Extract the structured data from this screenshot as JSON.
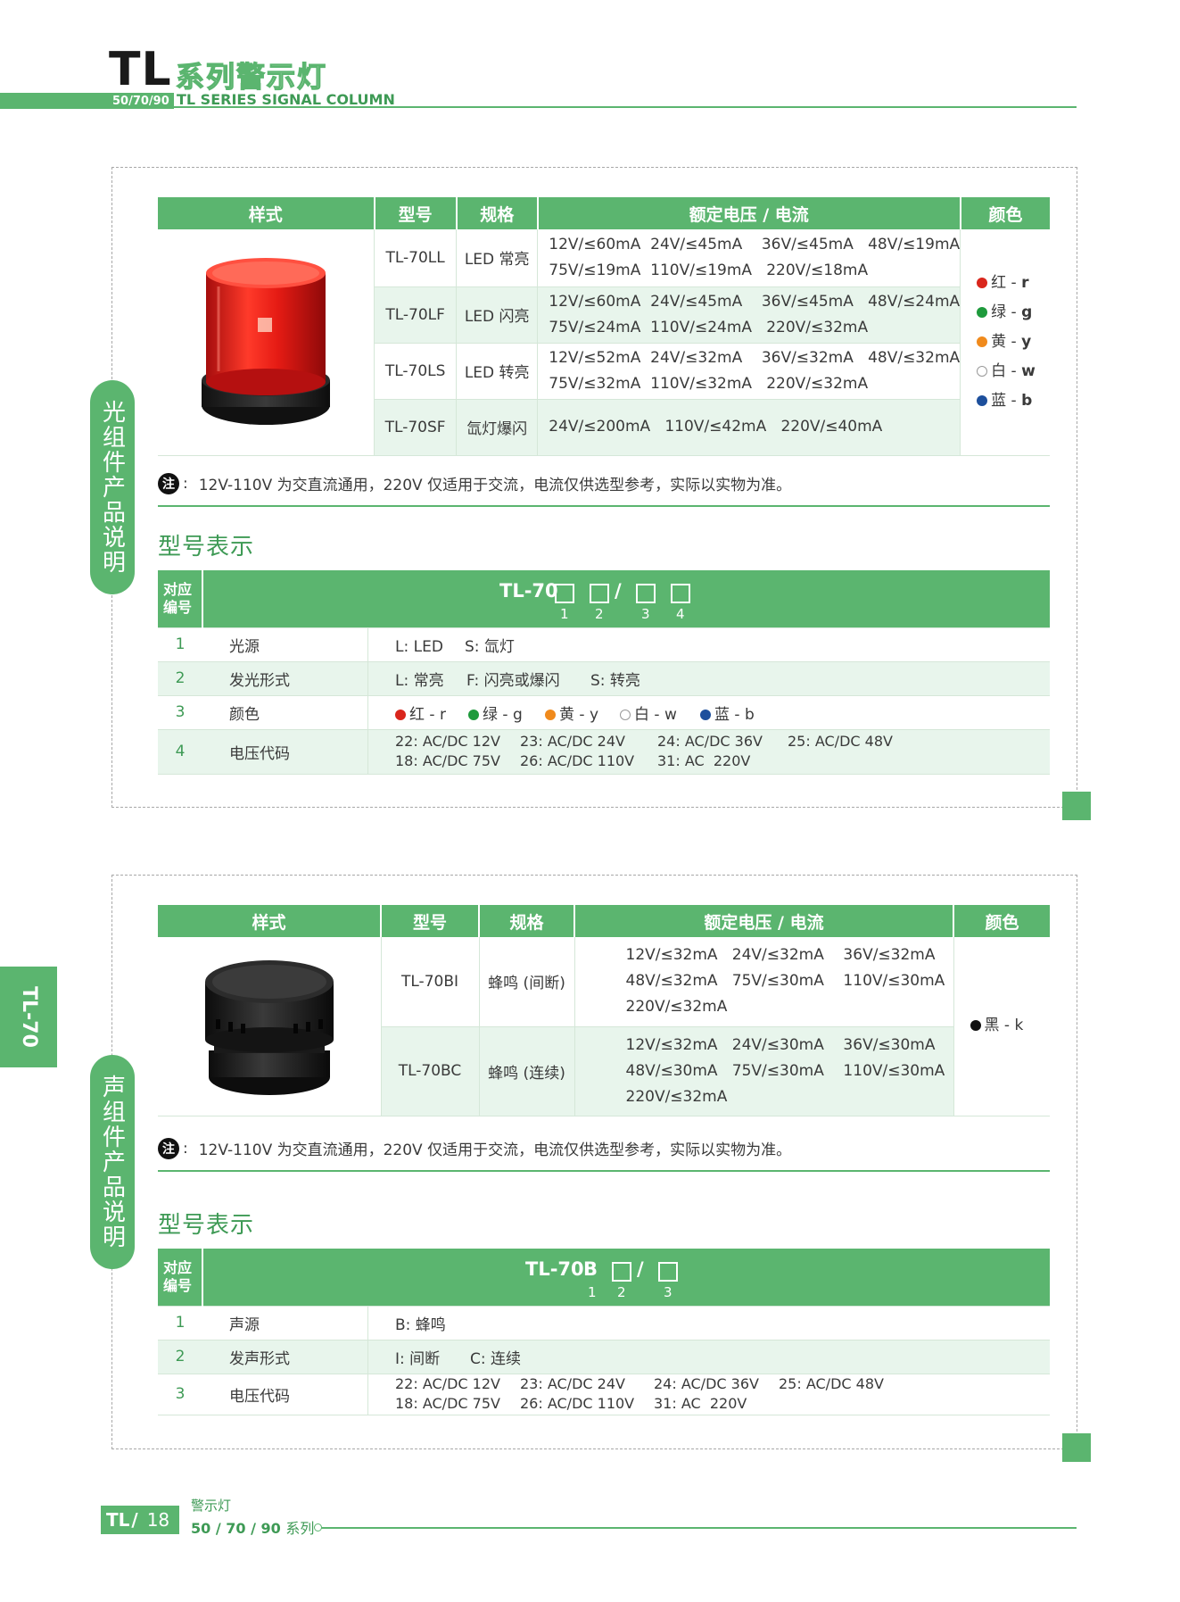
{
  "header": {
    "series_code": "TL",
    "title_cn": "系列警示灯",
    "sizes": "50/70/90",
    "title_en": "TL SERIES SIGNAL COLUMN"
  },
  "side_tab": "TL-70",
  "colors": {
    "accent": "#5bb56f",
    "red": "#d9261c",
    "green": "#1e9a3c",
    "yellow": "#f08a1c",
    "blue": "#1d4f9c",
    "black": "#111111"
  },
  "light_section": {
    "side_label": "光组件产品说明",
    "headers": [
      "样式",
      "型号",
      "规格",
      "额定电压 / 电流",
      "颜色"
    ],
    "rows": [
      {
        "model": "TL-70LL",
        "spec": "LED 常亮",
        "line1": "12V/≤60mA  24V/≤45mA    36V/≤45mA   48V/≤19mA",
        "line2": "75V/≤19mA  110V/≤19mA   220V/≤18mA"
      },
      {
        "model": "TL-70LF",
        "spec": "LED 闪亮",
        "line1": "12V/≤60mA  24V/≤45mA    36V/≤45mA   48V/≤24mA",
        "line2": "75V/≤24mA  110V/≤24mA   220V/≤32mA"
      },
      {
        "model": "TL-70LS",
        "spec": "LED 转亮",
        "line1": "12V/≤52mA  24V/≤32mA    36V/≤32mA   48V/≤32mA",
        "line2": "75V/≤32mA  110V/≤32mA   220V/≤32mA"
      },
      {
        "model": "TL-70SF",
        "spec": "氙灯爆闪",
        "line1": "24V/≤200mA   110V/≤42mA   220V/≤40mA",
        "line2": ""
      }
    ],
    "color_options": [
      {
        "cn": "红",
        "code": "r"
      },
      {
        "cn": "绿",
        "code": "g"
      },
      {
        "cn": "黄",
        "code": "y"
      },
      {
        "cn": "白",
        "code": "w"
      },
      {
        "cn": "蓝",
        "code": "b"
      }
    ],
    "note_mark": "注",
    "note": "12V-110V 为交直流通用，220V 仅适用于交流，电流仅供选型参考，实际以实物为准。",
    "code_title": "型号表示",
    "code_header": {
      "idx1": "对应",
      "idx2": "编号",
      "prefix": "TL-70",
      "slash": "/",
      "nums": [
        "1",
        "2",
        "3",
        "4"
      ]
    },
    "code_rows": [
      {
        "n": "1",
        "label": "光源",
        "v1": "L: LED",
        "v2": "S: 氙灯"
      },
      {
        "n": "2",
        "label": "发光形式",
        "v1": "L: 常亮",
        "v2": "F: 闪亮或爆闪",
        "v3": "S: 转亮"
      },
      {
        "n": "3",
        "label": "颜色",
        "c1": "红 - r",
        "c2": "绿 - g",
        "c3": "黄 - y",
        "c4": "白 - w",
        "c5": "蓝 - b"
      },
      {
        "n": "4",
        "label": "电压代码",
        "a1": "22: AC/DC 12V",
        "a2": "23: AC/DC 24V",
        "a3": "24: AC/DC 36V",
        "a4": "25: AC/DC 48V",
        "b1": "18: AC/DC 75V",
        "b2": "26: AC/DC 110V",
        "b3": "31: AC  220V"
      }
    ]
  },
  "sound_section": {
    "side_label": "声组件产品说明",
    "headers": [
      "样式",
      "型号",
      "规格",
      "额定电压 / 电流",
      "颜色"
    ],
    "rows": [
      {
        "model": "TL-70BI",
        "spec": "蜂鸣 (间断)",
        "line1": "12V/≤32mA   24V/≤32mA    36V/≤32mA",
        "line2": "48V/≤32mA   75V/≤30mA    110V/≤30mA",
        "line3": "220V/≤32mA"
      },
      {
        "model": "TL-70BC",
        "spec": "蜂鸣 (连续)",
        "line1": "12V/≤32mA   24V/≤30mA    36V/≤30mA",
        "line2": "48V/≤30mA   75V/≤30mA    110V/≤30mA",
        "line3": "220V/≤32mA"
      }
    ],
    "color_option": {
      "cn": "黑",
      "code": "k"
    },
    "note_mark": "注",
    "note": "12V-110V 为交直流通用，220V 仅适用于交流，电流仅供选型参考，实际以实物为准。",
    "code_title": "型号表示",
    "code_header": {
      "idx1": "对应",
      "idx2": "编号",
      "prefix": "TL-70",
      "letter": "B",
      "slash": "/",
      "nums": [
        "1",
        "2",
        "3"
      ]
    },
    "code_rows": [
      {
        "n": "1",
        "label": "声源",
        "v1": "B: 蜂鸣"
      },
      {
        "n": "2",
        "label": "发声形式",
        "v1": "I: 间断",
        "v2": "C: 连续"
      },
      {
        "n": "3",
        "label": "电压代码",
        "a1": "22: AC/DC 12V",
        "a2": "23: AC/DC 24V",
        "a3": "24: AC/DC 36V",
        "a4": "25: AC/DC 48V",
        "b1": "18: AC/DC 75V",
        "b2": "26: AC/DC 110V",
        "b3": "31: AC  220V"
      }
    ]
  },
  "footer": {
    "code": "TL",
    "slash": "/",
    "page": "18",
    "cn": "警示灯",
    "series_nums": "50 / 70 / 90",
    "series_word": "系列"
  }
}
